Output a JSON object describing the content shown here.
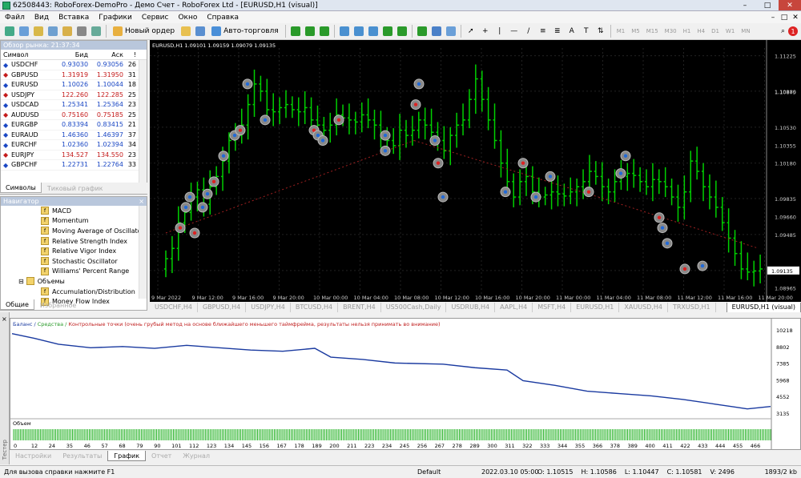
{
  "window": {
    "title": "62508443: RoboForex-DemoPro - Демо Счет - RoboForex Ltd - [EURUSD,H1 (visual)]",
    "min": "–",
    "max": "□",
    "close": "✕"
  },
  "menu": [
    "Файл",
    "Вид",
    "Вставка",
    "Графики",
    "Сервис",
    "Окно",
    "Справка"
  ],
  "toolbar": {
    "new_order": "Новый ордер",
    "autotrade": "Авто-торговля",
    "timeframes": [
      "M1",
      "M5",
      "M15",
      "M30",
      "H1",
      "H4",
      "D1",
      "W1",
      "MN"
    ]
  },
  "market_watch": {
    "header": "Обзор рынка: 21:37:34",
    "columns": [
      "Символ",
      "Бид",
      "Аск",
      "!"
    ],
    "rows": [
      {
        "symbol": "USDCHF",
        "bid": "0.93030",
        "ask": "0.93056",
        "spread": "26",
        "dir": "up"
      },
      {
        "symbol": "GBPUSD",
        "bid": "1.31919",
        "ask": "1.31950",
        "spread": "31",
        "dir": "down"
      },
      {
        "symbol": "EURUSD",
        "bid": "1.10026",
        "ask": "1.10044",
        "spread": "18",
        "dir": "up"
      },
      {
        "symbol": "USDJPY",
        "bid": "122.260",
        "ask": "122.285",
        "spread": "25",
        "dir": "down"
      },
      {
        "symbol": "USDCAD",
        "bid": "1.25341",
        "ask": "1.25364",
        "spread": "23",
        "dir": "up"
      },
      {
        "symbol": "AUDUSD",
        "bid": "0.75160",
        "ask": "0.75185",
        "spread": "25",
        "dir": "down"
      },
      {
        "symbol": "EURGBP",
        "bid": "0.83394",
        "ask": "0.83415",
        "spread": "21",
        "dir": "up"
      },
      {
        "symbol": "EURAUD",
        "bid": "1.46360",
        "ask": "1.46397",
        "spread": "37",
        "dir": "up"
      },
      {
        "symbol": "EURCHF",
        "bid": "1.02360",
        "ask": "1.02394",
        "spread": "34",
        "dir": "up"
      },
      {
        "symbol": "EURJPY",
        "bid": "134.527",
        "ask": "134.550",
        "spread": "23",
        "dir": "down"
      },
      {
        "symbol": "GBPCHF",
        "bid": "1.22731",
        "ask": "1.22764",
        "spread": "33",
        "dir": "up"
      }
    ],
    "tabs": [
      "Символы",
      "Тиковый график"
    ]
  },
  "navigator": {
    "header": "Навигатор",
    "close": "×",
    "items": [
      "MACD",
      "Momentum",
      "Moving Average of Oscillator",
      "Relative Strength Index",
      "Relative Vigor Index",
      "Stochastic Oscillator",
      "Williams' Percent Range"
    ],
    "folder": "Объемы",
    "sub": [
      "Accumulation/Distribution",
      "Money Flow Index"
    ],
    "tabs": [
      "Общие",
      "Избранное"
    ]
  },
  "chart": {
    "label": "EURUSD,H1  1.09101 1.09159 1.09079 1.09135",
    "price_labels": [
      "1.11225",
      "1.10880",
      "1.10530",
      "1.10180",
      "1.09835",
      "1.09485",
      "1.09135",
      "1.08965",
      "1.10875",
      "1.09660",
      "1.10355"
    ],
    "current_price": "1.09135",
    "time_labels": [
      "9 Mar 2022",
      "9 Mar 12:00",
      "9 Mar 16:00",
      "9 Mar 20:00",
      "10 Mar 00:00",
      "10 Mar 04:00",
      "10 Mar 08:00",
      "10 Mar 12:00",
      "10 Mar 16:00",
      "10 Mar 20:00",
      "11 Mar 00:00",
      "11 Mar 04:00",
      "11 Mar 08:00",
      "11 Mar 12:00",
      "11 Mar 16:00",
      "11 Mar 20:00"
    ],
    "tabs": [
      "USDCHF,H4",
      "GBPUSD,H4",
      "USDJPY,H4",
      "BTCUSD,H4",
      "BRENT,H4",
      "US500Cash,Daily",
      "USDRUB,H4",
      "AAPL,H4",
      "MSFT,H4",
      "EURUSD,H1",
      "XAUUSD,H4",
      "TRXUSD,H1",
      "EURUSD,H1 (visual)"
    ],
    "colors": {
      "bull": "#00c000",
      "bear": "#00c000",
      "grid": "#333333"
    }
  },
  "tester": {
    "legend_balance": "Баланс",
    "legend_equity": "Средства",
    "legend_note": "Контрольные точки (очень грубый метод на основе ближайшего меньшего таймфрейма, результаты нельзя принимать во внимание)",
    "y_labels": [
      "10218",
      "8802",
      "7385",
      "5968",
      "4552",
      "3135"
    ],
    "volume_label": "Объем",
    "x_labels": [
      "0",
      "12",
      "24",
      "35",
      "46",
      "57",
      "68",
      "79",
      "90",
      "101",
      "112",
      "123",
      "134",
      "145",
      "156",
      "167",
      "178",
      "189",
      "200",
      "211",
      "223",
      "234",
      "245",
      "256",
      "267",
      "278",
      "289",
      "300",
      "311",
      "322",
      "333",
      "344",
      "355",
      "366",
      "378",
      "389",
      "400",
      "411",
      "422",
      "433",
      "444",
      "455",
      "466"
    ],
    "tabs": [
      "Настройки",
      "Результаты",
      "График",
      "Отчет",
      "Журнал"
    ],
    "side_label": "Тестер"
  },
  "status": {
    "help": "Для вызова справки нажмите F1",
    "profile": "Default",
    "time": "2022.03.10 05:00",
    "open": "O: 1.10515",
    "high": "H: 1.10586",
    "low": "L: 1.10447",
    "close": "C: 1.10581",
    "volume": "V: 2496",
    "traffic": "1893/2 kb"
  }
}
